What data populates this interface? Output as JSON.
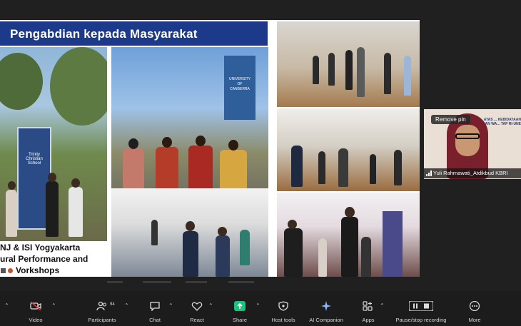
{
  "slide": {
    "title": "Pengabdian kepada Masyarakat",
    "sign_text": "Trinity Christian School",
    "banner_text": "UNIVERSITY OF CANBERRA",
    "caption_lines": [
      "NJ & ISI Yogyakarta",
      "ural Performance and",
      "Vorkshops"
    ]
  },
  "participant": {
    "remove_pin_label": "Remove pin",
    "name": "Yuli Rahmawati_Atdikbud KBRI",
    "background_text": "BIES ... ATAS ... KEBIDAYAAN DAN WA... TAP RI-UNE"
  },
  "toolbar": {
    "items": [
      {
        "label": "Video",
        "icon": "video-off-icon"
      },
      {
        "label": "Participants",
        "icon": "participants-icon",
        "count": "94"
      },
      {
        "label": "Chat",
        "icon": "chat-icon"
      },
      {
        "label": "React",
        "icon": "heart-icon"
      },
      {
        "label": "Share",
        "icon": "share-icon"
      },
      {
        "label": "Host tools",
        "icon": "shield-icon"
      },
      {
        "label": "AI Companion",
        "icon": "sparkle-icon"
      },
      {
        "label": "Apps",
        "icon": "apps-icon"
      },
      {
        "label": "Pause/stop recording",
        "icon": "pause-stop-icon"
      },
      {
        "label": "More",
        "icon": "more-icon"
      }
    ]
  },
  "colors": {
    "title_band": "#1d3a8a",
    "share_green": "#19c37d",
    "video_off_red": "#e23a3a",
    "toolbar_bg": "#1c1c1c"
  }
}
